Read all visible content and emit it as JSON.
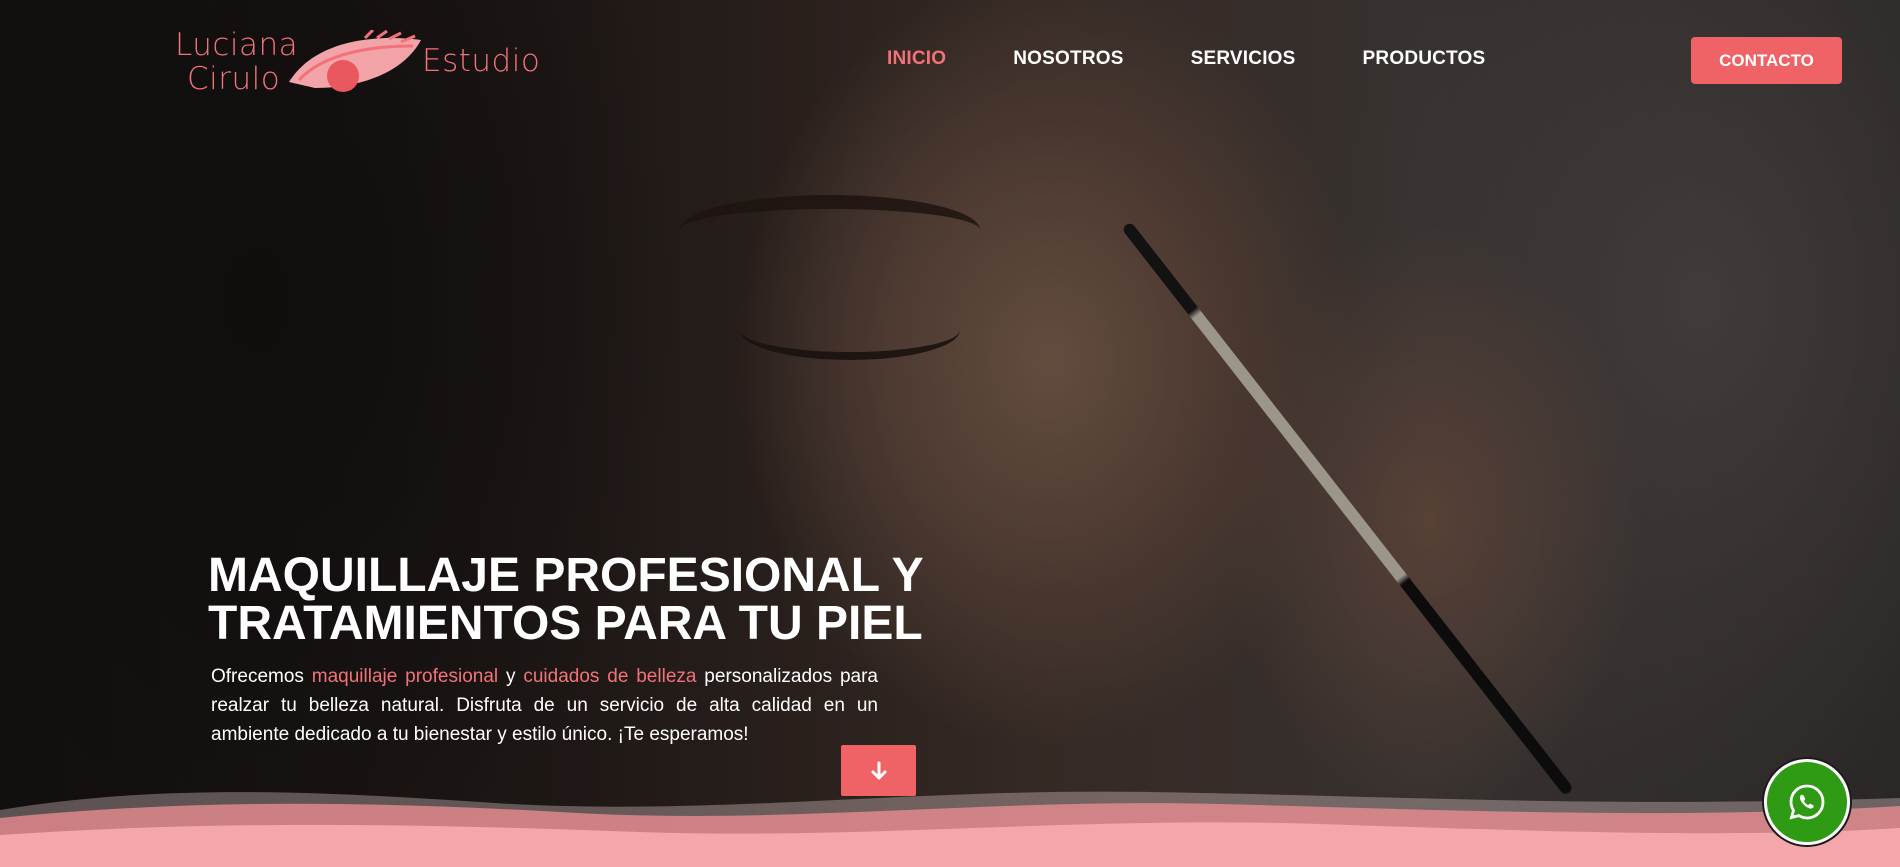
{
  "brand": {
    "name_line1": "Luciana",
    "name_line2": "Cirulo",
    "name_line3": "Estudio",
    "color": "#f2727a"
  },
  "nav": {
    "items": [
      {
        "label": "INICIO",
        "active": true
      },
      {
        "label": "NOSOTROS",
        "active": false
      },
      {
        "label": "SERVICIOS",
        "active": false
      },
      {
        "label": "PRODUCTOS",
        "active": false
      }
    ],
    "contact_label": "CONTACTO"
  },
  "hero": {
    "title": "MAQUILLAJE PROFESIONAL Y TRATAMIENTOS PARA TU PIEL",
    "text_part1": "Ofrecemos ",
    "highlight1": "maquillaje profesional",
    "text_part2": " y ",
    "highlight2": "cuidados de belleza",
    "text_part3": " personalizados para realzar tu belleza natural. Disfruta de un servicio de alta calidad en un ambiente dedicado a tu bienestar y estilo único. ¡Te esperamos!",
    "scroll_icon": "arrow-down-icon"
  },
  "whatsapp": {
    "icon": "whatsapp-icon",
    "color": "#2f9b14"
  },
  "colors": {
    "accent": "#ef6366",
    "wave_light": "#f4a7ab",
    "wave_mid": "#f08f94"
  }
}
